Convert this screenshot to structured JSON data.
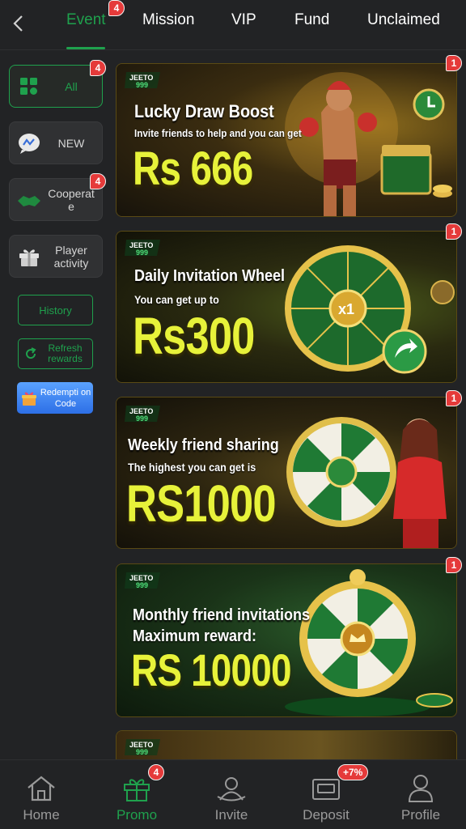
{
  "header": {
    "tabs": [
      {
        "label": "Event",
        "badge": "4"
      },
      {
        "label": "Mission"
      },
      {
        "label": "VIP"
      },
      {
        "label": "Fund"
      },
      {
        "label": "Unclaimed"
      }
    ]
  },
  "sidebar": {
    "items": [
      {
        "label": "All",
        "badge": "4",
        "icon": "grid-icon"
      },
      {
        "label": "NEW",
        "icon": "chat-bubble-icon"
      },
      {
        "label": "Cooperat e",
        "badge": "4",
        "icon": "handshake-icon"
      },
      {
        "label": "Player activity",
        "icon": "gift-box-icon"
      }
    ],
    "history_label": "History",
    "refresh_label": "Refresh rewards",
    "redemption_label": "Redempti on Code"
  },
  "banners": [
    {
      "logo": "JEETO 999",
      "title": "Lucky Draw Boost",
      "subtitle": "Invite friends to help and you can get",
      "amount": "Rs 666",
      "badge": "1"
    },
    {
      "logo": "JEETO 999",
      "title": "Daily Invitation Wheel",
      "subtitle": "You can get up to",
      "amount": "Rs300",
      "badge": "1",
      "wheel_center": "x1"
    },
    {
      "logo": "JEETO 999",
      "title": "Weekly friend sharing",
      "subtitle": "The highest you can get is",
      "amount": "RS1000",
      "badge": "1"
    },
    {
      "logo": "JEETO 999",
      "title": "Monthly friend invitations",
      "subtitle": "Maximum reward:",
      "amount": "RS 10000",
      "badge": "1"
    },
    {
      "logo": "JEETO 999"
    }
  ],
  "bottom_nav": [
    {
      "label": "Home",
      "icon": "home-icon"
    },
    {
      "label": "Promo",
      "icon": "gift-icon",
      "badge": "4"
    },
    {
      "label": "Invite",
      "icon": "invite-icon"
    },
    {
      "label": "Deposit",
      "icon": "wallet-icon",
      "badge": "+7%"
    },
    {
      "label": "Profile",
      "icon": "profile-icon"
    }
  ],
  "colors": {
    "accent": "#1fa14d",
    "badge": "#e53a3a",
    "amount": "#e7f23a",
    "background": "#222325"
  }
}
